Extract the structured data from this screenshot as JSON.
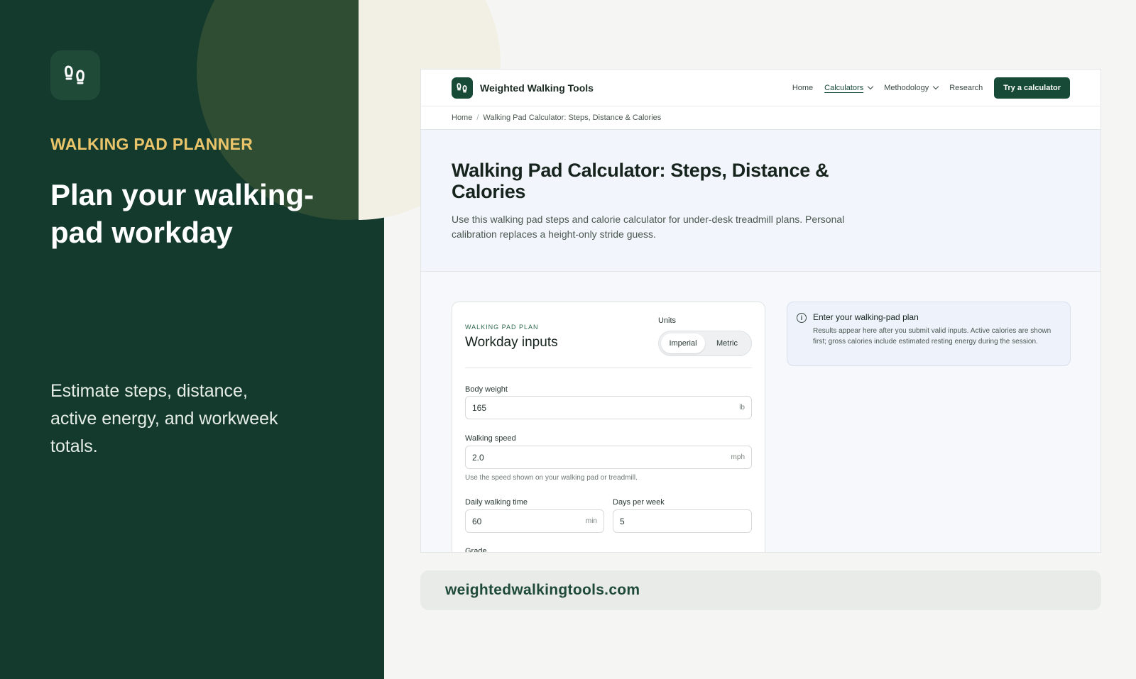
{
  "left": {
    "eyebrow": "WALKING PAD PLANNER",
    "title": "Plan your walking-pad workday",
    "subtitle": "Estimate steps, distance, active energy, and workweek totals."
  },
  "nav": {
    "brand": "Weighted Walking Tools",
    "links": [
      {
        "label": "Home"
      },
      {
        "label": "Calculators"
      },
      {
        "label": "Methodology"
      },
      {
        "label": "Research"
      }
    ],
    "cta": "Try a calculator"
  },
  "breadcrumb": {
    "home": "Home",
    "separator": "/",
    "current": "Walking Pad Calculator: Steps, Distance & Calories"
  },
  "hero": {
    "title": "Walking Pad Calculator: Steps, Distance & Calories",
    "description": "Use this walking pad steps and calorie calculator for under-desk treadmill plans. Personal calibration replaces a height-only stride guess."
  },
  "form": {
    "eyebrow": "WALKING PAD PLAN",
    "title": "Workday inputs",
    "units_label": "Units",
    "unit_options": [
      "Imperial",
      "Metric"
    ],
    "selected_unit": "Imperial",
    "body_weight": {
      "label": "Body weight",
      "value": "165",
      "unit": "lb"
    },
    "walking_speed": {
      "label": "Walking speed",
      "value": "2.0",
      "unit": "mph",
      "help": "Use the speed shown on your walking pad or treadmill."
    },
    "daily_time": {
      "label": "Daily walking time",
      "value": "60",
      "unit": "min"
    },
    "days_per_week": {
      "label": "Days per week",
      "value": "5"
    },
    "grade_label": "Grade"
  },
  "info": {
    "title": "Enter your walking-pad plan",
    "body": "Results appear here after you submit valid inputs. Active calories are shown first; gross calories include estimated resting energy during the session."
  },
  "url": "weightedwalkingtools.com",
  "colors": {
    "panel": "#133a2c",
    "accent": "#e9c46a",
    "brand": "#174a37"
  }
}
